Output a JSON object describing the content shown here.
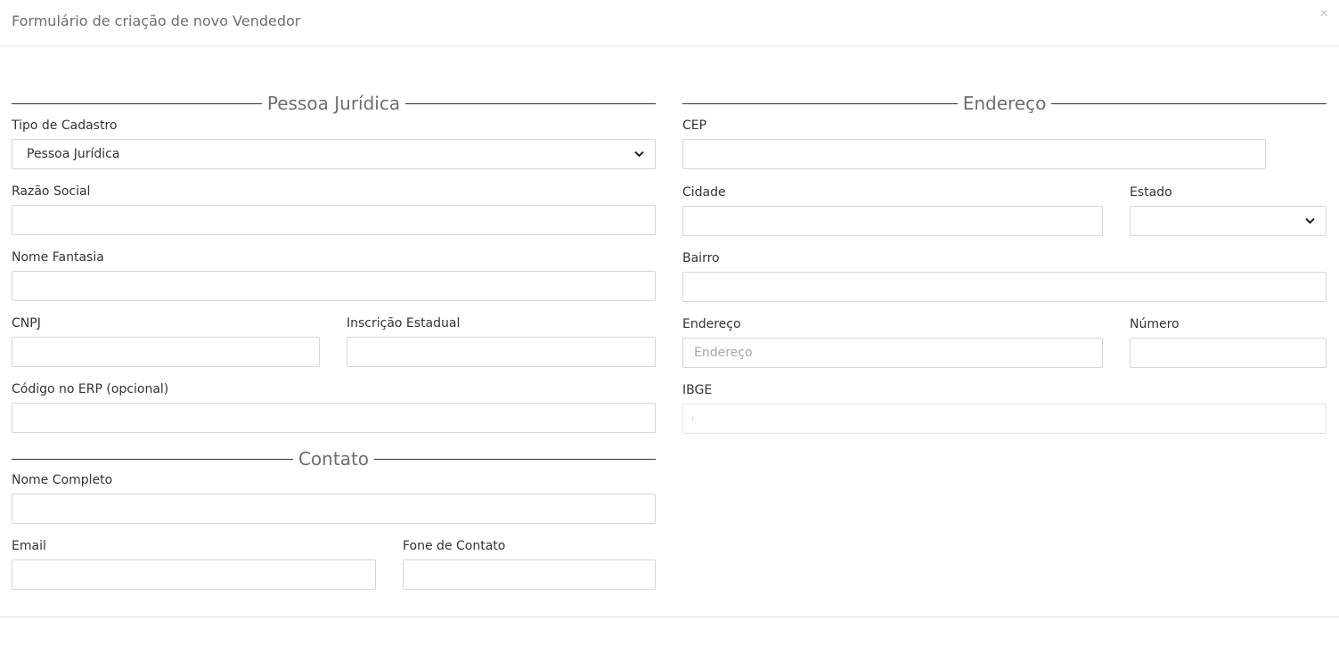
{
  "modal": {
    "title": "Formulário de criação de novo Vendedor",
    "close_label": "×"
  },
  "sections": {
    "pessoa_juridica": "Pessoa Jurídica",
    "endereco": "Endereço",
    "contato": "Contato"
  },
  "pj": {
    "tipo_cadastro_label": "Tipo de Cadastro",
    "tipo_cadastro_value": "Pessoa Jurídica",
    "razao_social_label": "Razão Social",
    "nome_fantasia_label": "Nome Fantasia",
    "cnpj_label": "CNPJ",
    "inscricao_estadual_label": "Inscrição Estadual",
    "codigo_erp_label": "Código no ERP (opcional)"
  },
  "contato": {
    "nome_completo_label": "Nome Completo",
    "email_label": "Email",
    "fone_label": "Fone de Contato"
  },
  "endereco": {
    "cep_label": "CEP",
    "cidade_label": "Cidade",
    "estado_label": "Estado",
    "estado_value": "",
    "bairro_label": "Bairro",
    "endereco_label": "Endereço",
    "endereco_placeholder": "Endereço",
    "numero_label": "Número",
    "ibge_label": "IBGE"
  },
  "icons": {
    "chevron": "⌄"
  }
}
